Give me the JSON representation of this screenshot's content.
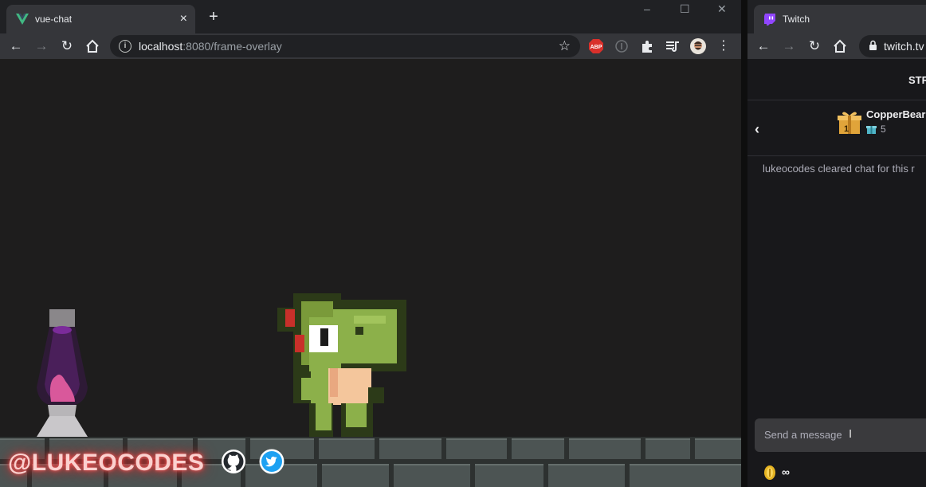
{
  "left_browser": {
    "tab_title": "vue-chat",
    "new_tab_label": "+",
    "url_host": "localhost",
    "url_rest": ":8080/frame-overlay",
    "window_controls": [
      "–",
      "☐",
      "✕"
    ],
    "extensions": [
      "abp-icon",
      "info-icon",
      "puzzle-icon",
      "media-icon",
      "profile-avatar"
    ],
    "abp_label": "ABP"
  },
  "overlay": {
    "handle": "@LUKEOCODES",
    "social_icons": [
      "github-icon",
      "twitter-icon"
    ]
  },
  "right_browser": {
    "tab_title": "Twitch",
    "url": "twitch.tv",
    "header_text": "STR",
    "sub_name": "CopperBear",
    "gift_count": "5",
    "gift_badge": "1",
    "chat_message": "lukeocodes cleared chat for this r",
    "input_placeholder": "Send a message",
    "points_value": "∞"
  },
  "colors": {
    "chrome_tabbar": "#202124",
    "chrome_toolbar": "#35363a",
    "twitch_bg": "#18181b",
    "twitch_purple": "#9146ff",
    "neon": "#ff5a5a"
  }
}
